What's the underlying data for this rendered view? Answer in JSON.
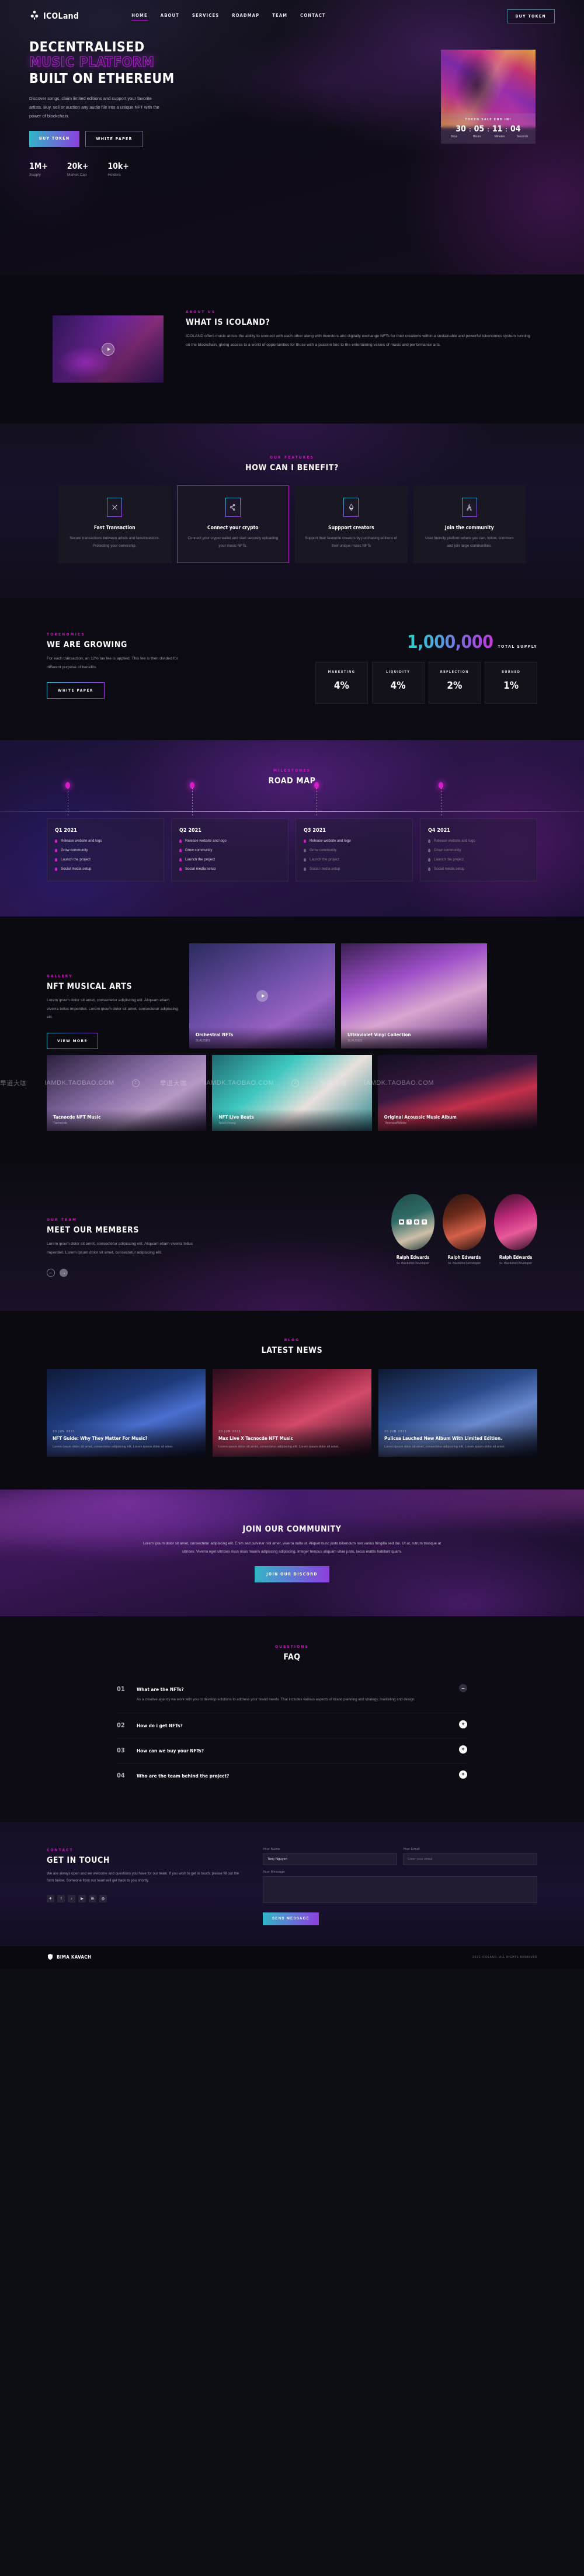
{
  "nav": {
    "brand": "ICOLand",
    "links": [
      "HOME",
      "ABOUT",
      "SERVICES",
      "ROADMAP",
      "TEAM",
      "CONTACT"
    ],
    "cta": "BUY TOKEN"
  },
  "hero": {
    "line1": "DECENTRALISED",
    "line2": "MUSIC PLATFORM",
    "line3": "BUILT ON ETHEREUM",
    "paragraph": "Discover songs, claim limited editions and support your favorite artists. Buy, sell or auction any audio file into a unique NFT with the power of blockchain.",
    "btn_primary": "BUY TOKEN",
    "btn_secondary": "WHITE PAPER",
    "stats": [
      {
        "value": "1M+",
        "label": "Supply"
      },
      {
        "value": "20k+",
        "label": "Market Cap"
      },
      {
        "value": "10k+",
        "label": "Holders"
      }
    ],
    "countdown": {
      "title": "TOKEN SALE END IN!",
      "values": [
        "30",
        "05",
        "11",
        "04"
      ],
      "labels": [
        "Days",
        "Hours",
        "Minutes",
        "Seconds"
      ],
      "separator": ":"
    }
  },
  "about": {
    "eyebrow": "ABOUT US",
    "title": "WHAT IS ICOLAND?",
    "paragraph": "ICOLAND offers music artists the ability to connect with each other along with investors and digitally exchange NFTs for their creations within a sustainable and powerful tokenomics system running on the blockchain, giving access to a world of opportunities for those with a passion tied to the entertaining values of music and performance arts."
  },
  "features": {
    "eyebrow": "OUR FEATURES",
    "title": "HOW CAN I BENEFIT?",
    "cards": [
      {
        "icon": "transaction-icon",
        "title": "Fast Transaction",
        "text": "Secure transactions between artists and fans/investors. Protecting your ownership.",
        "highlighted": false
      },
      {
        "icon": "share-node-icon",
        "title": "Connect your crypto",
        "text": "Connect your crypto wallet and start securely uploading your music NFTs.",
        "highlighted": true
      },
      {
        "icon": "ethereum-icon",
        "title": "Suppport creators",
        "text": "Support their favourite creators by purchasing editions of their unique music NFTs",
        "highlighted": false
      },
      {
        "icon": "community-icon",
        "title": "Join the community",
        "text": "User friendly platform where you can, follow, comment and join large communities.",
        "highlighted": false
      }
    ]
  },
  "tokenomics": {
    "eyebrow": "TOKENOMICS",
    "title": "WE ARE GROWING",
    "paragraph": "For each transaction, an 12% tax fee is applied. This fee is then divided for different purpose of benefits.",
    "button": "WHITE PAPER",
    "supply_value": "1,000,000",
    "supply_label": "TOTAL SUPPLY",
    "breakdown": [
      {
        "key": "MARKETING",
        "value": "4%"
      },
      {
        "key": "LIQUIDITY",
        "value": "4%"
      },
      {
        "key": "REFLECTION",
        "value": "2%"
      },
      {
        "key": "BURNED",
        "value": "1%"
      }
    ]
  },
  "roadmap": {
    "eyebrow": "MILESTONES",
    "title": "ROAD MAP",
    "quarters": [
      {
        "label": "Q1 2021",
        "items": [
          {
            "text": "Release website and logo",
            "done": true
          },
          {
            "text": "Grow community",
            "done": true
          },
          {
            "text": "Launch the project",
            "done": true
          },
          {
            "text": "Social media setup",
            "done": true
          }
        ]
      },
      {
        "label": "Q2 2021",
        "items": [
          {
            "text": "Release website and logo",
            "done": true
          },
          {
            "text": "Grow community",
            "done": true
          },
          {
            "text": "Launch the project",
            "done": true
          },
          {
            "text": "Social media setup",
            "done": true
          }
        ]
      },
      {
        "label": "Q3 2021",
        "items": [
          {
            "text": "Release website and logo",
            "done": true
          },
          {
            "text": "Grow community",
            "done": false
          },
          {
            "text": "Launch the project",
            "done": false
          },
          {
            "text": "Social media setup",
            "done": false
          }
        ]
      },
      {
        "label": "Q4 2021",
        "items": [
          {
            "text": "Release website and logo",
            "done": false
          },
          {
            "text": "Grow community",
            "done": false
          },
          {
            "text": "Launch the project",
            "done": false
          },
          {
            "text": "Social media setup",
            "done": false
          }
        ]
      }
    ]
  },
  "gallery": {
    "eyebrow": "GALLERY",
    "title": "NFT MUSICAL ARTS",
    "paragraph": "Lorem ipsum dolor sit amet, consectetur adipiscing elit. Aliquam etiam viverra tellus imperdiet. Lorem ipsum dolor sit amet, consectetur adipiscing elit.",
    "button": "VIEW MORE",
    "items_top": [
      {
        "title": "Orchestral NFTs",
        "author": "3LAUSES"
      },
      {
        "title": "Ultraviolet Vinyl Collection",
        "author": "3LAUSES"
      }
    ],
    "items_bottom": [
      {
        "title": "Tacnocde NFT Music",
        "author": "Tacnocde"
      },
      {
        "title": "NFT Live Beats",
        "author": "NickkYoung"
      },
      {
        "title": "Original Acoussic Music Album",
        "author": "ThomasWWote"
      }
    ],
    "watermark": "IAMDK.TAOBAO.COM",
    "watermark_cn": "早道大咖"
  },
  "team": {
    "eyebrow": "OUR TEAM",
    "title": "MEET OUR MEMBERS",
    "paragraph": "Lorem ipsum dolor sit amet, consectetur adipiscing elit. Aliquam etiam viverra tellus imperdiet. Lorem ipsum dolor sit amet, consectetur adipiscing elit.",
    "members": [
      {
        "name": "Ralph Edwards",
        "role": "Sr. Backend Developer"
      },
      {
        "name": "Ralph Edwards",
        "role": "Sr. Backend Developer"
      },
      {
        "name": "Ralph Edwards",
        "role": "Sr. Backend Developer"
      }
    ],
    "socials": [
      "in",
      "f",
      "◎",
      "℗"
    ]
  },
  "news": {
    "eyebrow": "BLOG",
    "title": "LATEST NEWS",
    "posts": [
      {
        "date": "20 JUN 2021",
        "title": "NFT Guide: Why They Matter For Music?",
        "excerpt": "Lorem ipsum dolor sit amet, consectetur adipiscing elit. Lorem ipsum dolor sit amet."
      },
      {
        "date": "20 JUN 2021",
        "title": "Max Live X Tacnocde NFT Music",
        "excerpt": "Lorem ipsum dolor sit amet, consectetur adipiscing elit. Lorem ipsum dolor sit amet."
      },
      {
        "date": "20 JUN 2021",
        "title": "Pulicsa Lauched New Album With Limited Edition.",
        "excerpt": "Lorem ipsum dolor sit amet, consectetur adipiscing elit. Lorem ipsum dolor sit amet."
      }
    ]
  },
  "community": {
    "title": "JOIN OUR COMMUNITY",
    "paragraph": "Lorem ipsum dolor sit amet, consectetur adipiscing elit. Enim sed pulvinar nisl amet, viverra nulla ut. Aliquet nunc justo bibendum non varius fringilla sed dui. Ut at, rutrum tristique at ultrices. Viverra eget ultricies risus risus mauris adipiscing adipiscing. Integer tempus aliquam vitae justo, lacus mattis habitant quam.",
    "button": "JOIN OUR DISCORD"
  },
  "faq": {
    "eyebrow": "QUESTIONS",
    "title": "FAQ",
    "items": [
      {
        "no": "01",
        "q": "What are the NFTs?",
        "a": "As a creative agency we work with you to develop solutions to address your brand needs. That includes various aspects of brand planning and strategy, marketing and design.",
        "open": true,
        "toggle": "–"
      },
      {
        "no": "02",
        "q": "How do i get NFTs?",
        "a": "",
        "open": false,
        "toggle": "+"
      },
      {
        "no": "03",
        "q": "How can we buy your NFTs?",
        "a": "",
        "open": false,
        "toggle": "+"
      },
      {
        "no": "04",
        "q": "Who are the team behind the project?",
        "a": "",
        "open": false,
        "toggle": "+"
      }
    ]
  },
  "contact": {
    "eyebrow": "CONTACT",
    "title": "GET IN TOUCH",
    "paragraph": "We are always open and we welcome and questions you have for our team. If you wish to get in touch, please fill out the form below. Someone from our team will get back to you shortly.",
    "socials": [
      "✈",
      "f",
      "♪",
      "▶",
      "in",
      "◎"
    ],
    "form": {
      "name_label": "Your Name",
      "name_placeholder": "Tony Nguyen",
      "email_label": "Your Email",
      "email_placeholder": "Enter your email",
      "message_label": "Your Message",
      "message_placeholder": "",
      "submit": "SEND MESSAGE"
    }
  },
  "footer": {
    "brand": "BIMA KAVACH",
    "copyright": "2021 ICOLAND. ALL RIGHTS RESERVED"
  }
}
